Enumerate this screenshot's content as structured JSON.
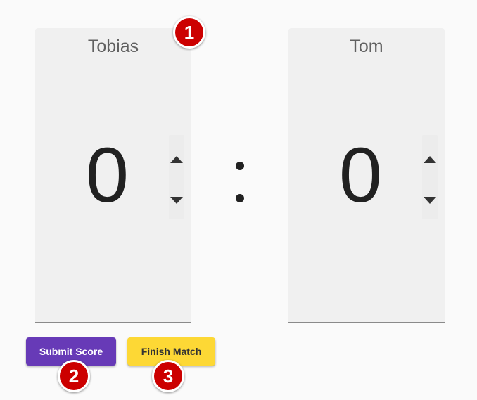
{
  "players": [
    {
      "name": "Tobias",
      "score": "0"
    },
    {
      "name": "Tom",
      "score": "0"
    }
  ],
  "separator": ":",
  "buttons": {
    "submit_label": "Submit Score",
    "finish_label": "Finish Match"
  },
  "annotations": [
    "1",
    "2",
    "3"
  ],
  "colors": {
    "submit_bg": "#673ab7",
    "finish_bg": "#fdd835",
    "marker_bg": "#cc0000",
    "panel_bg": "#f0f0f0"
  }
}
